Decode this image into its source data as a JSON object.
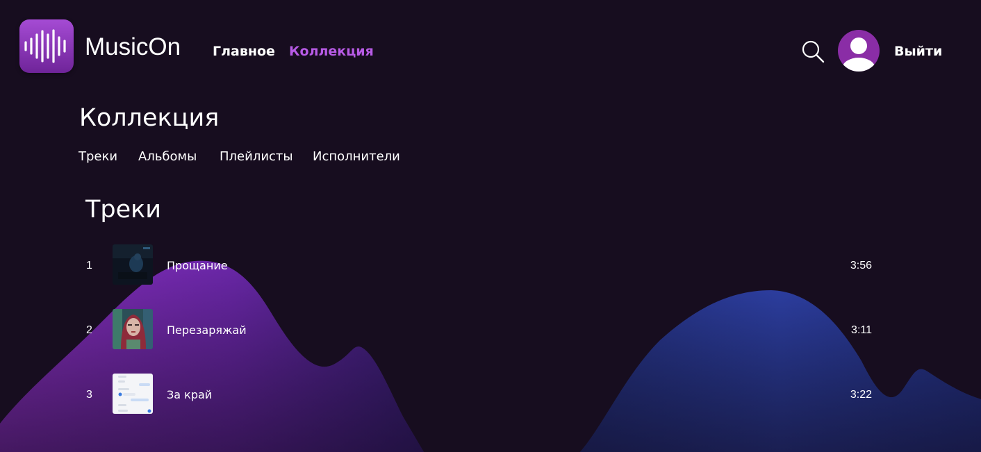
{
  "header": {
    "brand": "MusicOn",
    "nav": [
      {
        "label": "Главное",
        "active": false
      },
      {
        "label": "Коллекция",
        "active": true
      }
    ],
    "logout_label": "Выйти",
    "search_icon": "search-icon",
    "avatar_icon": "user-avatar-icon"
  },
  "page": {
    "title": "Коллекция",
    "tabs": [
      "Треки",
      "Альбомы",
      "Плейлисты",
      "Исполнители"
    ]
  },
  "tracks_section": {
    "title": "Треки",
    "tracks": [
      {
        "number": "1",
        "title": "Прощание",
        "duration": "3:56"
      },
      {
        "number": "2",
        "title": "Перезаряжай",
        "duration": "3:11"
      },
      {
        "number": "3",
        "title": "За край",
        "duration": "3:22"
      }
    ]
  },
  "colors": {
    "background": "#170d1f",
    "accent": "#b85be6",
    "logo_gradient_top": "#a54bd4",
    "logo_gradient_bottom": "#6f2499",
    "avatar": "#8a2da6",
    "wave_left": "#7a2bb0",
    "wave_right": "#2b3a9a"
  }
}
